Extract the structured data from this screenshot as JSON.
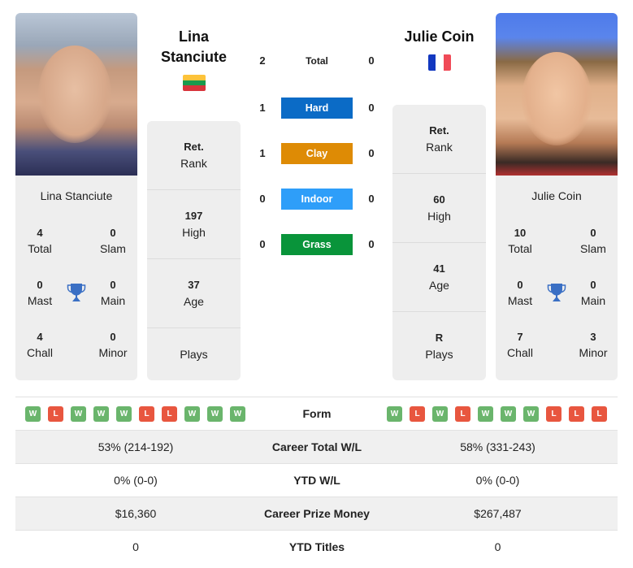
{
  "left_player": {
    "name_line1": "Lina",
    "name_line2": "Stanciute",
    "card_name": "Lina Stanciute",
    "country": "Lithuania",
    "flag_colors": [
      "#fdb913",
      "#006a44",
      "#c1272d"
    ],
    "titles": {
      "total": {
        "value": "4",
        "label": "Total"
      },
      "slam": {
        "value": "0",
        "label": "Slam"
      },
      "mast": {
        "value": "0",
        "label": "Mast"
      },
      "main": {
        "value": "0",
        "label": "Main"
      },
      "chall": {
        "value": "4",
        "label": "Chall"
      },
      "minor": {
        "value": "0",
        "label": "Minor"
      }
    },
    "info": {
      "rank": {
        "value": "Ret.",
        "label": "Rank"
      },
      "high": {
        "value": "197",
        "label": "High"
      },
      "age": {
        "value": "37",
        "label": "Age"
      },
      "plays": {
        "value": "",
        "label": "Plays"
      }
    },
    "form": [
      "W",
      "L",
      "W",
      "W",
      "W",
      "L",
      "L",
      "W",
      "W",
      "W"
    ]
  },
  "right_player": {
    "name": "Julie Coin",
    "card_name": "Julie Coin",
    "country": "France",
    "flag_colors": [
      "#0a36b8",
      "#ffffff",
      "#f04a57"
    ],
    "titles": {
      "total": {
        "value": "10",
        "label": "Total"
      },
      "slam": {
        "value": "0",
        "label": "Slam"
      },
      "mast": {
        "value": "0",
        "label": "Mast"
      },
      "main": {
        "value": "0",
        "label": "Main"
      },
      "chall": {
        "value": "7",
        "label": "Chall"
      },
      "minor": {
        "value": "3",
        "label": "Minor"
      }
    },
    "info": {
      "rank": {
        "value": "Ret.",
        "label": "Rank"
      },
      "high": {
        "value": "60",
        "label": "High"
      },
      "age": {
        "value": "41",
        "label": "Age"
      },
      "plays": {
        "value": "R",
        "label": "Plays"
      }
    },
    "form": [
      "W",
      "L",
      "W",
      "L",
      "W",
      "W",
      "W",
      "L",
      "L",
      "L"
    ]
  },
  "h2h": [
    {
      "label": "Total",
      "left": "2",
      "right": "0",
      "color": ""
    },
    {
      "label": "Hard",
      "left": "1",
      "right": "0",
      "color": "#0b6bc6"
    },
    {
      "label": "Clay",
      "left": "1",
      "right": "0",
      "color": "#de8b05"
    },
    {
      "label": "Indoor",
      "left": "0",
      "right": "0",
      "color": "#2e9ef9"
    },
    {
      "label": "Grass",
      "left": "0",
      "right": "0",
      "color": "#09943a"
    }
  ],
  "table": {
    "form_label": "Form",
    "rows": [
      {
        "label": "Career Total W/L",
        "left": "53% (214-192)",
        "right": "58% (331-243)"
      },
      {
        "label": "YTD W/L",
        "left": "0% (0-0)",
        "right": "0% (0-0)"
      },
      {
        "label": "Career Prize Money",
        "left": "$16,360",
        "right": "$267,487"
      },
      {
        "label": "YTD Titles",
        "left": "0",
        "right": "0"
      }
    ]
  }
}
